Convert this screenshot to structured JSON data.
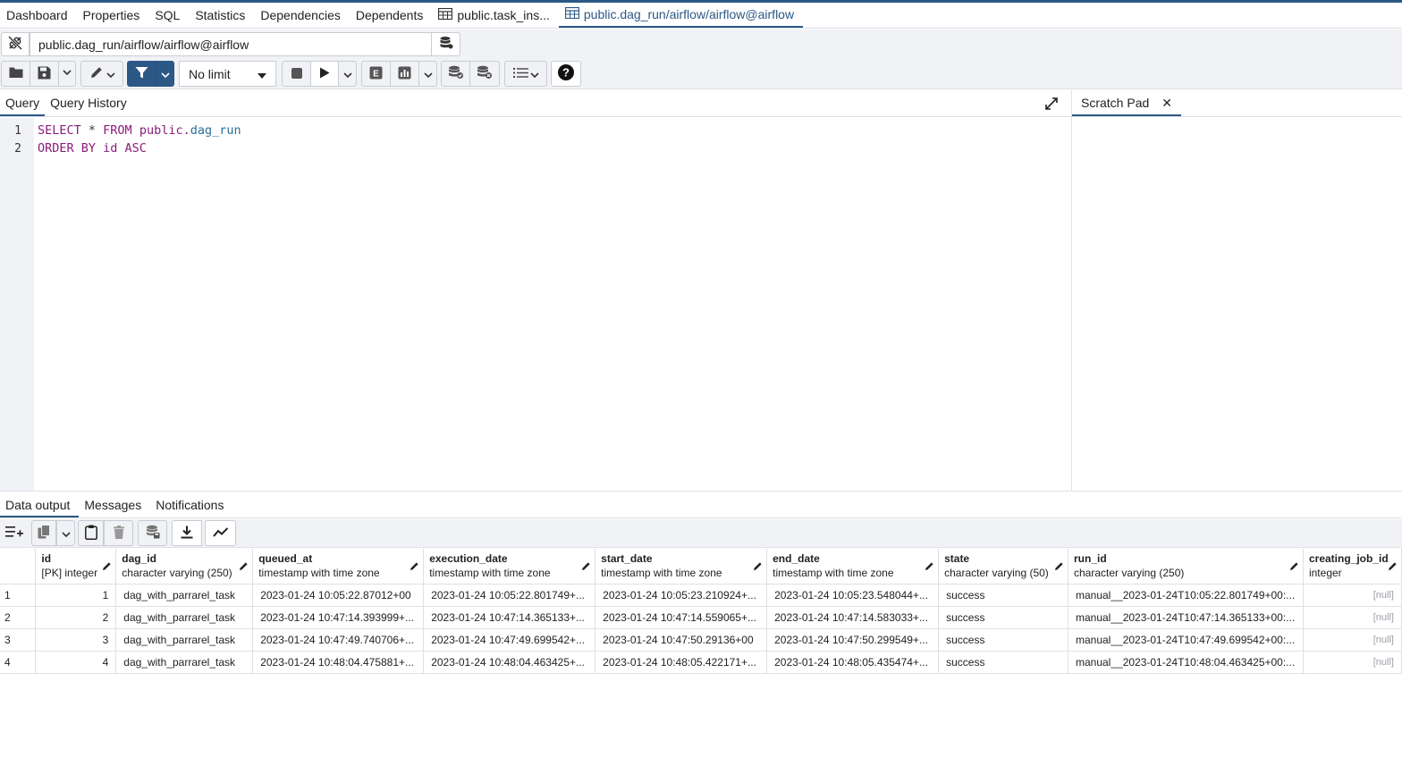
{
  "tabs": [
    {
      "label": "Dashboard",
      "icon": ""
    },
    {
      "label": "Properties",
      "icon": ""
    },
    {
      "label": "SQL",
      "icon": ""
    },
    {
      "label": "Statistics",
      "icon": ""
    },
    {
      "label": "Dependencies",
      "icon": ""
    },
    {
      "label": "Dependents",
      "icon": ""
    },
    {
      "label": "public.task_ins...",
      "icon": "table-icon"
    },
    {
      "label": "public.dag_run/airflow/airflow@airflow",
      "icon": "table-icon"
    }
  ],
  "connection": {
    "value": "public.dag_run/airflow/airflow@airflow"
  },
  "toolbar": {
    "limit_label": "No limit"
  },
  "query_tabs": {
    "query": "Query",
    "history": "Query History"
  },
  "editor": {
    "lines": [
      {
        "n": "1",
        "t1": "SELECT",
        "t2": " * ",
        "t3": "FROM",
        "t4": " public.",
        "t5": "dag_run"
      },
      {
        "n": "2",
        "t1": "ORDER BY",
        "t2": " id ",
        "t3": "ASC",
        "t4": "",
        "t5": ""
      }
    ]
  },
  "scratch": {
    "title": "Scratch Pad",
    "close": "✕"
  },
  "output_tabs": {
    "data": "Data output",
    "messages": "Messages",
    "notifications": "Notifications"
  },
  "grid": {
    "columns": [
      {
        "name": "id",
        "type": "[PK] integer"
      },
      {
        "name": "dag_id",
        "type": "character varying (250)"
      },
      {
        "name": "queued_at",
        "type": "timestamp with time zone"
      },
      {
        "name": "execution_date",
        "type": "timestamp with time zone"
      },
      {
        "name": "start_date",
        "type": "timestamp with time zone"
      },
      {
        "name": "end_date",
        "type": "timestamp with time zone"
      },
      {
        "name": "state",
        "type": "character varying (50)"
      },
      {
        "name": "run_id",
        "type": "character varying (250)"
      },
      {
        "name": "creating_job_id",
        "type": "integer"
      }
    ],
    "rows": [
      {
        "rn": "1",
        "id": "1",
        "dag_id": "dag_with_parrarel_task",
        "queued_at": "2023-01-24 10:05:22.87012+00",
        "execution_date": "2023-01-24 10:05:22.801749+...",
        "start_date": "2023-01-24 10:05:23.210924+...",
        "end_date": "2023-01-24 10:05:23.548044+...",
        "state": "success",
        "run_id": "manual__2023-01-24T10:05:22.801749+00:...",
        "creating_job_id": "[null]"
      },
      {
        "rn": "2",
        "id": "2",
        "dag_id": "dag_with_parrarel_task",
        "queued_at": "2023-01-24 10:47:14.393999+...",
        "execution_date": "2023-01-24 10:47:14.365133+...",
        "start_date": "2023-01-24 10:47:14.559065+...",
        "end_date": "2023-01-24 10:47:14.583033+...",
        "state": "success",
        "run_id": "manual__2023-01-24T10:47:14.365133+00:...",
        "creating_job_id": "[null]"
      },
      {
        "rn": "3",
        "id": "3",
        "dag_id": "dag_with_parrarel_task",
        "queued_at": "2023-01-24 10:47:49.740706+...",
        "execution_date": "2023-01-24 10:47:49.699542+...",
        "start_date": "2023-01-24 10:47:50.29136+00",
        "end_date": "2023-01-24 10:47:50.299549+...",
        "state": "success",
        "run_id": "manual__2023-01-24T10:47:49.699542+00:...",
        "creating_job_id": "[null]"
      },
      {
        "rn": "4",
        "id": "4",
        "dag_id": "dag_with_parrarel_task",
        "queued_at": "2023-01-24 10:48:04.475881+...",
        "execution_date": "2023-01-24 10:48:04.463425+...",
        "start_date": "2023-01-24 10:48:05.422171+...",
        "end_date": "2023-01-24 10:48:05.435474+...",
        "state": "success",
        "run_id": "manual__2023-01-24T10:48:04.463425+00:...",
        "creating_job_id": "[null]"
      }
    ]
  },
  "colors": {
    "accent": "#2c5886",
    "keyword": "#8a1c7a",
    "identifier": "#2c6e9e",
    "panel": "#f1f2f5"
  }
}
